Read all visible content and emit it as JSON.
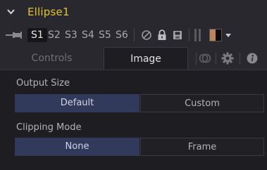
{
  "title": "Ellipse1",
  "versions": [
    "S1",
    "S2",
    "S3",
    "S4",
    "S5",
    "S6"
  ],
  "active_version": "S1",
  "toolbar_icons": [
    "pin-icon",
    "disable-icon",
    "lock-icon",
    "save-icon",
    "color-swatch-icon",
    "dropdown-caret-icon"
  ],
  "tabs": [
    {
      "label": "Controls",
      "active": false
    },
    {
      "label": "Image",
      "active": true
    },
    {
      "label": "",
      "icon": "mask-icon"
    },
    {
      "label": "",
      "icon": "gear-icon"
    },
    {
      "label": "",
      "icon": "info-icon"
    }
  ],
  "output_size": {
    "label": "Output Size",
    "options": [
      "Default",
      "Custom"
    ],
    "selected": "Default"
  },
  "clipping_mode": {
    "label": "Clipping Mode",
    "options": [
      "None",
      "Frame"
    ],
    "selected": "None"
  },
  "colors": {
    "title": "#e5c52a",
    "selected_segment": "#323a5c",
    "swatch_left": "#b8855a",
    "swatch_right": "#0b0b0b"
  }
}
